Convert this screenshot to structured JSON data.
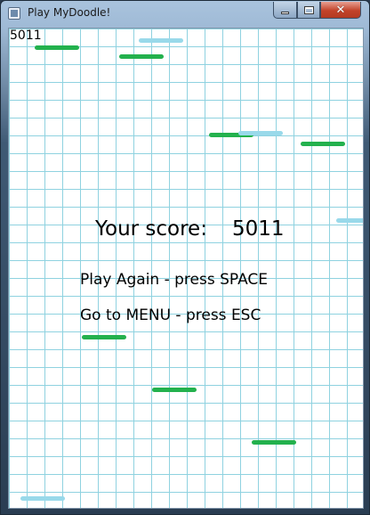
{
  "window": {
    "title": "Play MyDoodle!",
    "close_symbol": "✕"
  },
  "hud": {
    "score": "5011"
  },
  "game_over": {
    "score_label": "Your score:",
    "score_value": "5011",
    "play_again": "Play Again - press SPACE",
    "menu": "Go to MENU - press ESC"
  },
  "colors": {
    "platform_green": "#23b14d",
    "platform_blue": "#99d9ea",
    "grid_line": "#8fd2e0"
  },
  "platforms": [
    {
      "type": "green"
    },
    {
      "type": "blue"
    },
    {
      "type": "green"
    },
    {
      "type": "green"
    },
    {
      "type": "blue"
    },
    {
      "type": "green"
    },
    {
      "type": "blue"
    },
    {
      "type": "green"
    },
    {
      "type": "green"
    },
    {
      "type": "green"
    },
    {
      "type": "blue"
    }
  ]
}
